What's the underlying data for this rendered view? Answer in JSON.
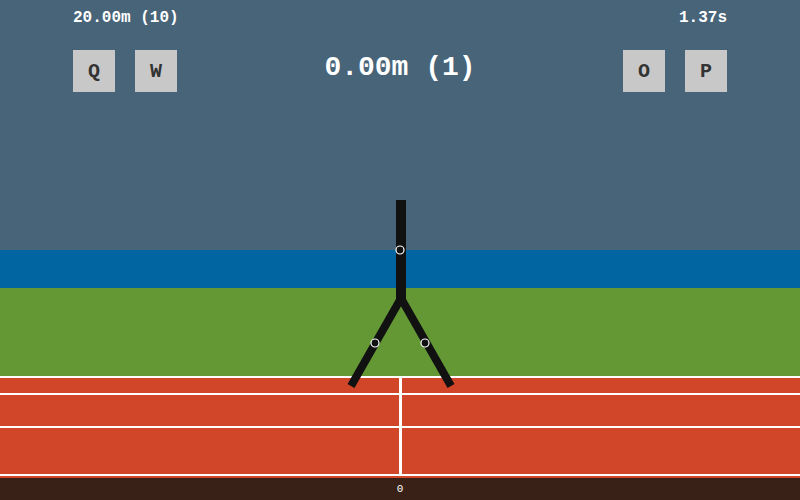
{
  "hud": {
    "best": "20.00m (10)",
    "time": "1.37s",
    "distance": "0.00m (1)"
  },
  "keys_left": [
    "Q",
    "W"
  ],
  "keys_right": [
    "O",
    "P"
  ],
  "track": {
    "marker": "0"
  }
}
